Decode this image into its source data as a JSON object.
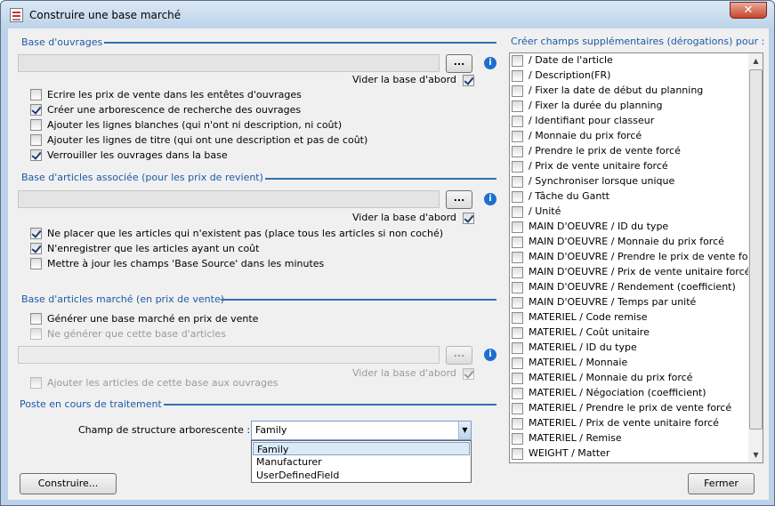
{
  "window": {
    "title": "Construire une base marché",
    "close_symbol": "✕"
  },
  "section1": {
    "title": "Base d'ouvrages",
    "browse": "...",
    "clear_label": "Vider la base d'abord",
    "clear_checked": true,
    "options": [
      {
        "label": "Ecrire les prix de vente dans les entêtes d'ouvrages",
        "checked": false
      },
      {
        "label": "Créer une arborescence de recherche des ouvrages",
        "checked": true
      },
      {
        "label": "Ajouter les lignes blanches (qui n'ont ni description, ni coût)",
        "checked": false
      },
      {
        "label": "Ajouter les lignes de titre (qui ont une description et pas de coût)",
        "checked": false
      },
      {
        "label": "Verrouiller les ouvrages dans la base",
        "checked": true
      }
    ]
  },
  "section2": {
    "title": "Base d'articles associée (pour les prix de revient)",
    "browse": "...",
    "clear_label": "Vider la base d'abord",
    "clear_checked": true,
    "options": [
      {
        "label": "Ne placer que les articles qui n'existent pas (place tous les articles si non coché)",
        "checked": true
      },
      {
        "label": "N'enregistrer que les articles ayant un coût",
        "checked": true
      },
      {
        "label": "Mettre à jour les champs 'Base Source' dans les minutes",
        "checked": false
      }
    ]
  },
  "section3": {
    "title": "Base d'articles marché (en prix de vente)",
    "browse": "...",
    "clear_label": "Vider la base d'abord",
    "clear_checked": true,
    "generate": {
      "label": "Générer une base marché en prix de vente",
      "checked": false
    },
    "only": {
      "label": "Ne générer que cette base d'articles",
      "checked": false
    },
    "add": {
      "label": "Ajouter les articles de cette base aux ouvrages",
      "checked": false
    }
  },
  "section4": {
    "title": "Poste en cours de traitement",
    "field_label": "Champ de structure arborescente :",
    "value": "Family",
    "options": [
      "Family",
      "Manufacturer",
      "UserDefinedField"
    ]
  },
  "right": {
    "title": "Créer champs supplémentaires (dérogations) pour :",
    "items": [
      "/ Date de l'article",
      "/ Description(FR)",
      "/ Fixer la date de début du planning",
      "/ Fixer la durée du planning",
      "/ Identifiant pour classeur",
      "/ Monnaie du prix forcé",
      "/ Prendre le prix de vente forcé",
      "/ Prix de vente unitaire forcé",
      "/ Synchroniser lorsque unique",
      "/ Tâche du Gantt",
      "/ Unité",
      "MAIN D'OEUVRE / ID du type",
      "MAIN D'OEUVRE / Monnaie du prix forcé",
      "MAIN D'OEUVRE / Prendre le prix de vente forcé",
      "MAIN D'OEUVRE / Prix de vente unitaire forcé",
      "MAIN D'OEUVRE / Rendement (coefficient)",
      "MAIN D'OEUVRE / Temps par unité",
      "MATERIEL / Code remise",
      "MATERIEL / Coût unitaire",
      "MATERIEL / ID du type",
      "MATERIEL / Monnaie",
      "MATERIEL / Monnaie du prix forcé",
      "MATERIEL / Négociation (coefficient)",
      "MATERIEL / Prendre le prix de vente forcé",
      "MATERIEL / Prix de vente unitaire forcé",
      "MATERIEL / Remise",
      "WEIGHT / Matter"
    ]
  },
  "buttons": {
    "build": "Construire...",
    "close": "Fermer"
  },
  "icons": {
    "info": "i",
    "scroll_up": "▲",
    "scroll_down": "▼",
    "dropdown": "▼"
  }
}
